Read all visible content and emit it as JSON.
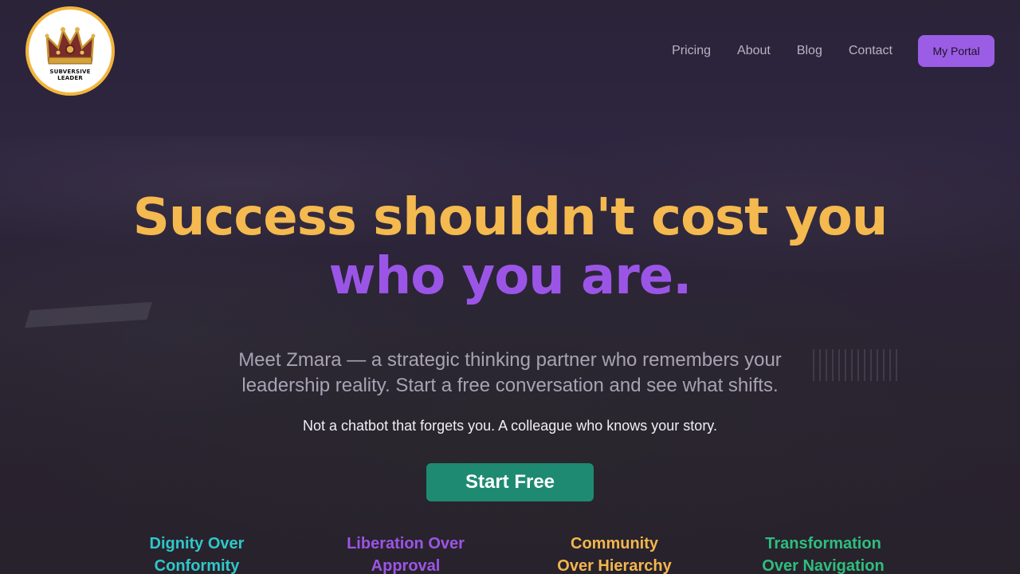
{
  "logo": {
    "line1": "SUBVERSIVE",
    "line2": "LEADER",
    "icon": "crown-icon"
  },
  "nav": {
    "items": [
      "Pricing",
      "About",
      "Blog",
      "Contact"
    ],
    "portal": "My Portal"
  },
  "hero": {
    "headline_line1": "Success shouldn't cost you",
    "headline_line2": "who you are.",
    "subtitle": "Meet Zmara — a strategic thinking partner who remembers your leadership reality. Start a free conversation and see what shifts.",
    "tagline": "Not a chatbot that forgets you. A colleague who knows your story.",
    "cta": "Start Free"
  },
  "values": [
    {
      "line1": "Dignity Over",
      "line2": "Conformity",
      "color": "#2fc7c9"
    },
    {
      "line1": "Liberation Over",
      "line2": "Approval",
      "color": "#9b55e6"
    },
    {
      "line1": "Community",
      "line2": "Over Hierarchy",
      "color": "#f2b64e"
    },
    {
      "line1": "Transformation",
      "line2": "Over Navigation",
      "color": "#2ebe7e"
    }
  ],
  "colors": {
    "accent_gold": "#f4b94f",
    "accent_purple": "#9b55e6",
    "cta_green": "#1e8a72"
  }
}
